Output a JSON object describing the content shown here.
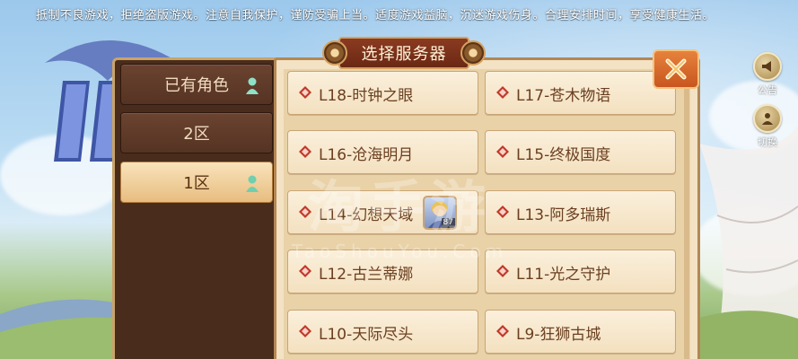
{
  "notice": "抵制不良游戏，拒绝盗版游戏。注意自我保护，谨防受骗上当。适度游戏益脑，沉迷游戏伤身。合理安排时间，享受健康生活。",
  "side_buttons": [
    {
      "label": "公告",
      "icon": "megaphone-icon"
    },
    {
      "label": "切换",
      "icon": "switch-account-icon"
    }
  ],
  "dialog": {
    "title": "选择服务器",
    "close_icon": "close-icon"
  },
  "tabs": [
    {
      "label": "已有角色",
      "has_character": true,
      "active": false
    },
    {
      "label": "2区",
      "has_character": false,
      "active": false
    },
    {
      "label": "1区",
      "has_character": true,
      "active": true
    }
  ],
  "servers": [
    {
      "name": "L18-时钟之眼",
      "avatar": false
    },
    {
      "name": "L17-苍木物语",
      "avatar": false
    },
    {
      "name": "L16-沧海明月",
      "avatar": false
    },
    {
      "name": "L15-终极国度",
      "avatar": false
    },
    {
      "name": "L14-幻想天域",
      "avatar": true,
      "avatar_level": "87"
    },
    {
      "name": "L13-阿多瑞斯",
      "avatar": false
    },
    {
      "name": "L12-古兰蒂娜",
      "avatar": false
    },
    {
      "name": "L11-光之守护",
      "avatar": false
    },
    {
      "name": "L10-天际尽头",
      "avatar": false
    },
    {
      "name": "L9-狂狮古城",
      "avatar": false
    }
  ],
  "watermark": {
    "main": "淘手游",
    "sub": "TaoShouYou.Com"
  },
  "colors": {
    "panel_bg": "#f3e2c3",
    "tab_dark": "#553323",
    "tab_active": "#e7bd80",
    "server_text": "#6b3f20",
    "diamond_red": "#c0392b",
    "close_orange": "#d9692b"
  }
}
